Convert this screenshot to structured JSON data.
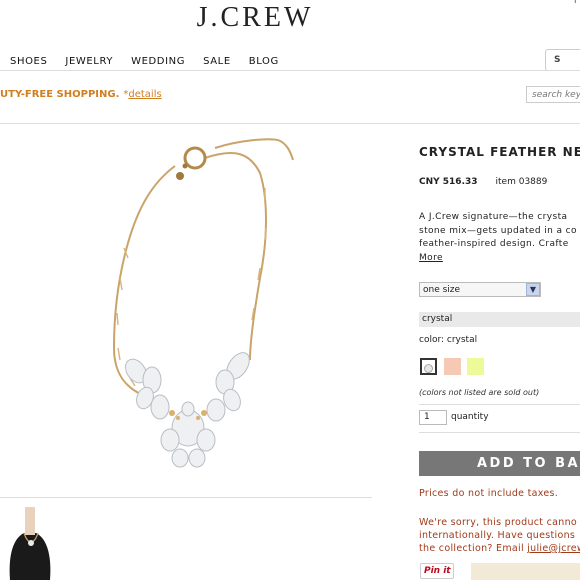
{
  "header": {
    "logo": "J.CREW",
    "corner_mark": "ı",
    "nav": [
      "SHOES",
      "JEWELRY",
      "WEDDING",
      "SALE",
      "BLOG"
    ],
    "search_label": "S"
  },
  "promo": {
    "text": "UTY-FREE SHOPPING.",
    "link_prefix": "*",
    "link_text": "details",
    "search_placeholder": "search key"
  },
  "product": {
    "title": "CRYSTAL FEATHER NEC",
    "price": "CNY 516.33",
    "item": "item 03889",
    "description_lines": [
      "A J.Crew signature—the crysta",
      "stone mix—gets updated in a co",
      "feather-inspired design. Crafte"
    ],
    "more": "More",
    "size_value": "one size",
    "color_value": "crystal",
    "color_label": "color: crystal",
    "swatches": [
      "#ffffff",
      "#f6c9b5",
      "#eefa9a"
    ],
    "unavailable_note": "(colors not listed are sold out)",
    "quantity": "1",
    "quantity_label": "quantity",
    "add_to_bag": "ADD TO BAG",
    "price_note": "Prices do not include taxes.",
    "shipping_note_1": "We're sorry, this product canno",
    "shipping_note_2": "internationally. Have questions",
    "shipping_note_3_prefix": "the collection? Email ",
    "shipping_email": "julie@jcrew",
    "pinit": "Pin it"
  },
  "colors": {
    "promo": "#cf7f1f",
    "notice": "#a13a1a",
    "button": "#777777"
  }
}
